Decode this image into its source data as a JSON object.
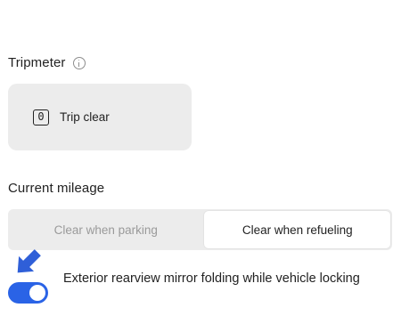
{
  "tripmeter": {
    "title": "Tripmeter",
    "info_icon": "info-icon",
    "card": {
      "icon_text": "0",
      "label": "Trip clear"
    }
  },
  "current_mileage": {
    "title": "Current mileage",
    "options": [
      {
        "label": "Clear when parking",
        "selected": false
      },
      {
        "label": "Clear when refueling",
        "selected": true
      }
    ]
  },
  "mirror_toggle": {
    "label": "Exterior rearview mirror folding while vehicle locking",
    "state": true
  },
  "colors": {
    "accent": "#2a63e6",
    "pointer": "#2f5fd8",
    "card_bg": "#ececec"
  }
}
